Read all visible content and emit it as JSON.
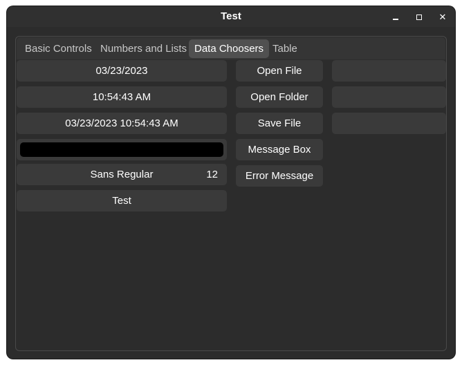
{
  "window": {
    "title": "Test"
  },
  "tabs": [
    {
      "label": "Basic Controls",
      "active": false
    },
    {
      "label": "Numbers and Lists",
      "active": false
    },
    {
      "label": "Data Choosers",
      "active": true
    },
    {
      "label": "Table",
      "active": false
    }
  ],
  "left_column": {
    "date_button": "03/23/2023",
    "time_button": "10:54:43 AM",
    "datetime_button": "03/23/2023 10:54:43 AM",
    "color_button": {
      "color": "#000000"
    },
    "font_button": {
      "family": "Sans Regular",
      "size": "12"
    },
    "test_button": "Test"
  },
  "middle_column": {
    "open_file": "Open File",
    "open_folder": "Open Folder",
    "save_file": "Save File",
    "message_box": "Message Box",
    "error_message": "Error Message"
  },
  "right_column": {
    "open_file_result": "",
    "open_folder_result": "",
    "save_file_result": ""
  }
}
